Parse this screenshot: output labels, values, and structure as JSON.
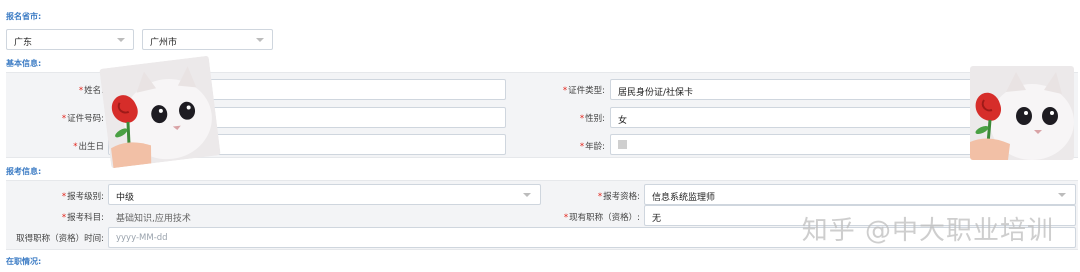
{
  "sections": {
    "province_city": "报名省市:",
    "basic_info": "基本信息:",
    "exam_info": "报考信息:",
    "employment": "在职情况:"
  },
  "location": {
    "province": "广东",
    "city": "广州市"
  },
  "basic": {
    "name_label": "姓名:",
    "id_number_label": "证件号码:",
    "birth_label": "出生日",
    "id_type_label": "证件类型:",
    "id_type_value": "居民身份证/社保卡",
    "gender_label": "性别:",
    "gender_value": "女",
    "age_label": "年龄:"
  },
  "exam": {
    "level_label": "报考级别:",
    "level_value": "中级",
    "qualification_label": "报考资格:",
    "qualification_value": "信息系统监理师",
    "subjects_label": "报考科目:",
    "subjects_value": "基础知识,应用技术",
    "current_title_label": "现有职称（资格）:",
    "current_title_value": "无",
    "obtain_time_label": "取得职称（资格）时间:",
    "obtain_time_placeholder": "yyyy-MM-dd"
  },
  "watermark": "知乎 @中大职业培训",
  "icons": {
    "sticker": "cat-with-rose-sticker"
  }
}
